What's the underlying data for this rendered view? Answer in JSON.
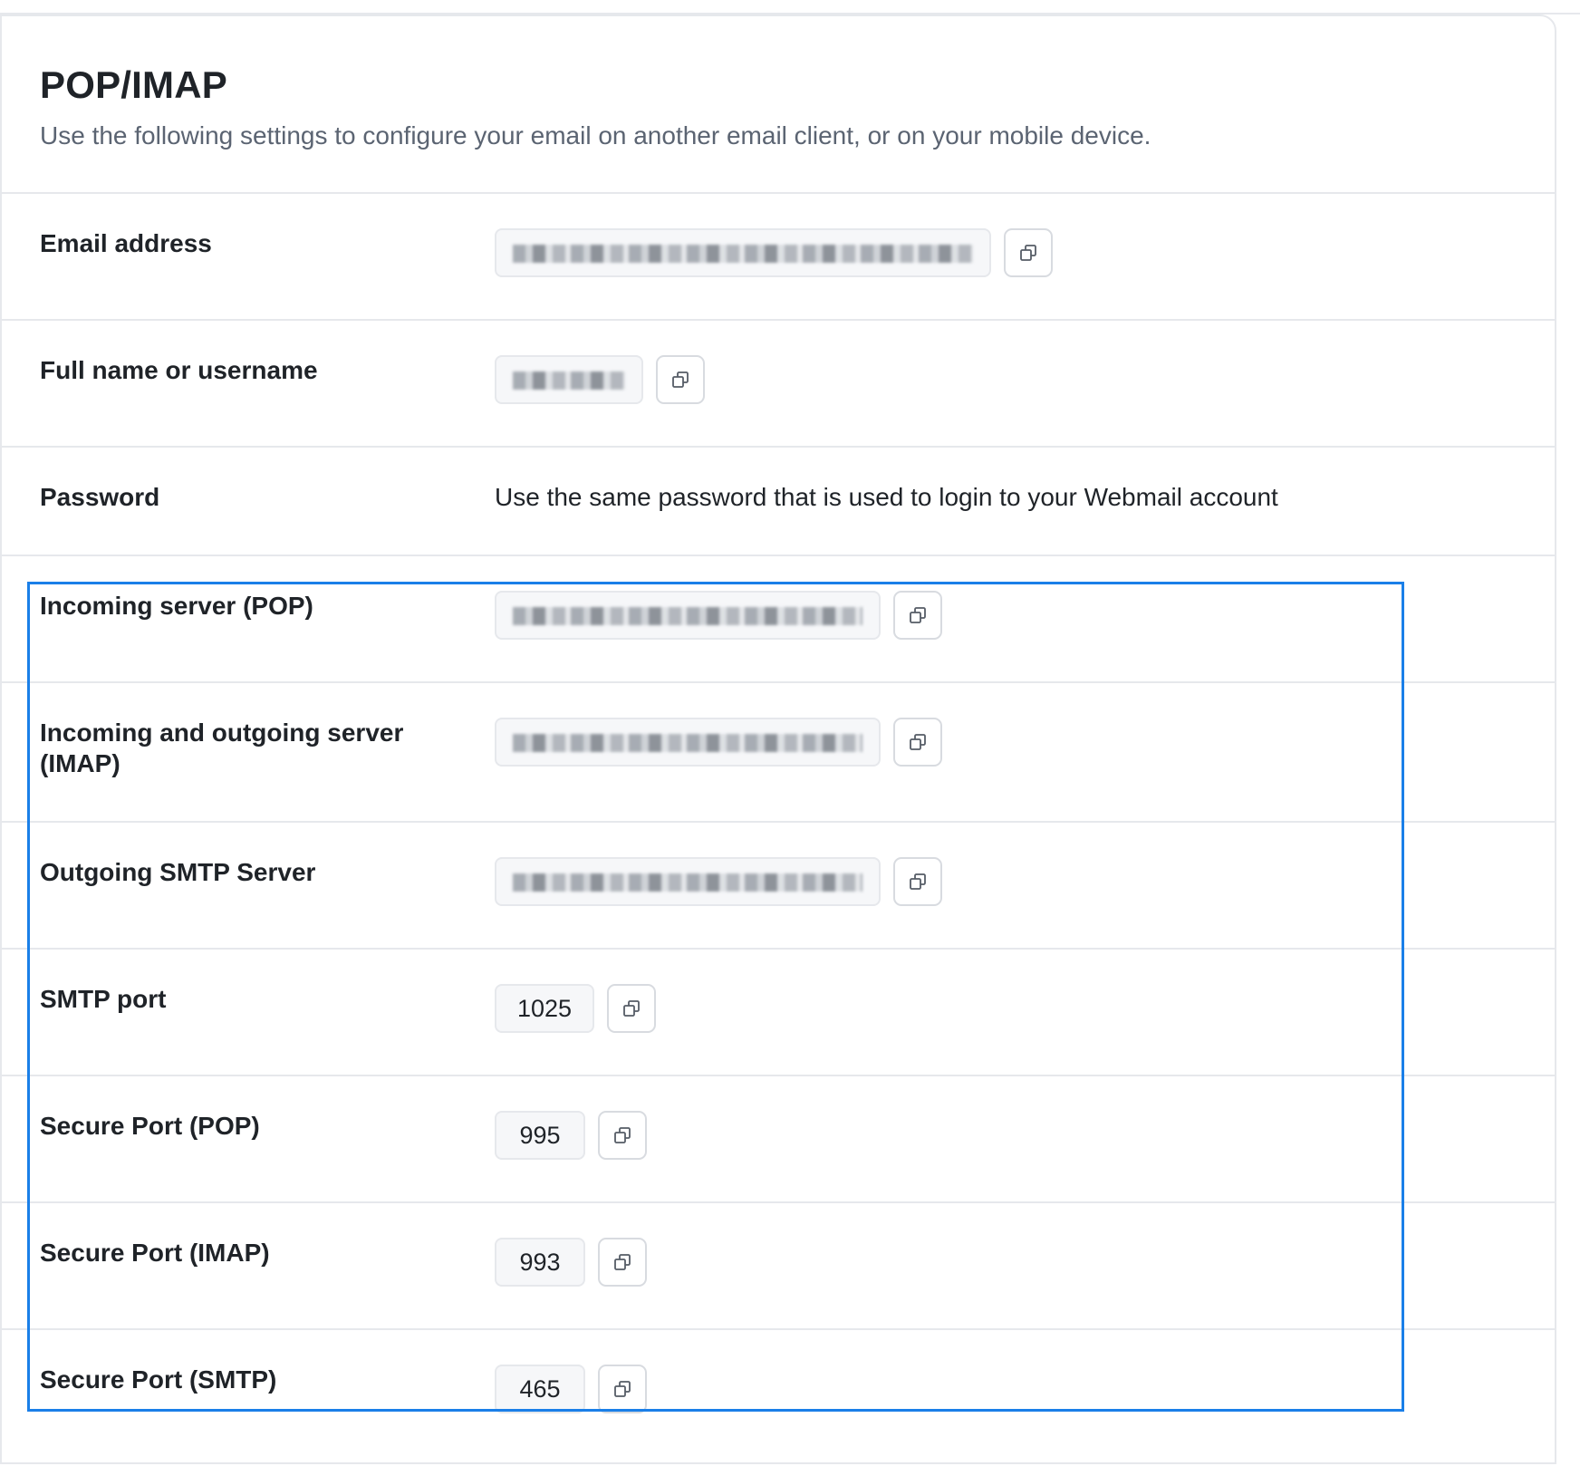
{
  "section": {
    "title": "POP/IMAP",
    "subtitle": "Use the following settings to configure your email on another email client, or on your mobile device."
  },
  "rows": [
    {
      "label": "Email address",
      "value": "",
      "redacted": true
    },
    {
      "label": "Full name or username",
      "value": "",
      "redacted": true
    },
    {
      "label": "Password",
      "text": "Use the same password that is used to login to your Webmail account"
    },
    {
      "label": "Incoming server (POP)",
      "value": "",
      "redacted": true
    },
    {
      "label": "Incoming and outgoing server (IMAP)",
      "value": "",
      "redacted": true
    },
    {
      "label": "Outgoing SMTP Server",
      "value": "",
      "redacted": true
    },
    {
      "label": "SMTP port",
      "value": "1025"
    },
    {
      "label": "Secure Port (POP)",
      "value": "995"
    },
    {
      "label": "Secure Port (IMAP)",
      "value": "993"
    },
    {
      "label": "Secure Port (SMTP)",
      "value": "465"
    }
  ],
  "icons": {
    "copy": "copy-icon"
  },
  "colors": {
    "highlight": "#1a7fe8",
    "border": "#e6e8ec",
    "muted_text": "#5b6472"
  }
}
